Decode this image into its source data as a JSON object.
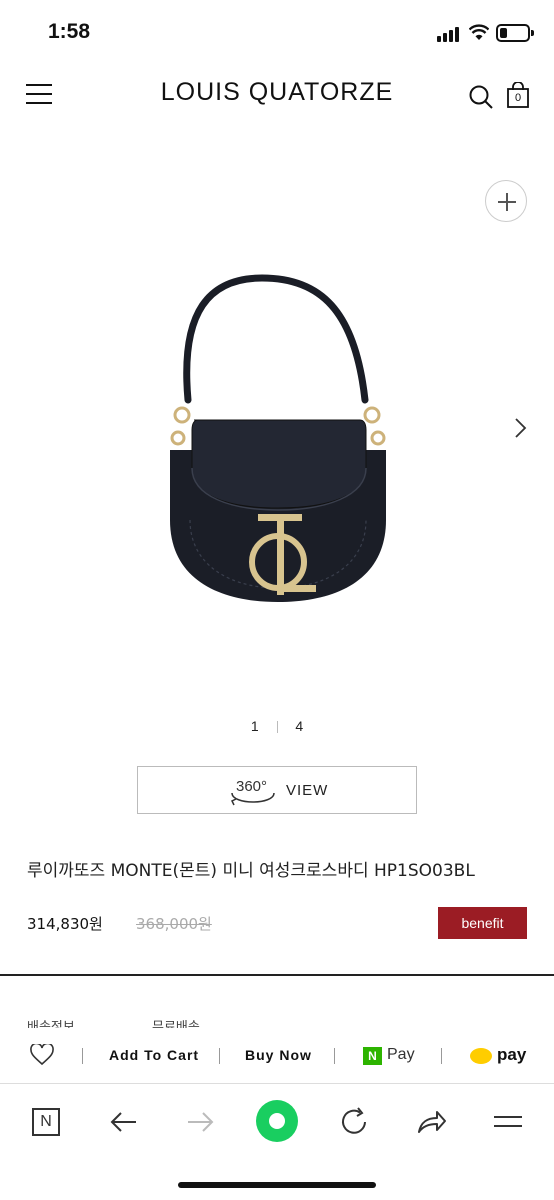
{
  "status_bar": {
    "time": "1:58",
    "battery_level": 0.25
  },
  "header": {
    "brand": "LOUIS QUATORZE",
    "cart_count": "0"
  },
  "gallery": {
    "current": "1",
    "total": "4"
  },
  "view_360": {
    "badge": "360°",
    "label": "VIEW"
  },
  "product": {
    "title": "루이까또즈 MONTE(몬트) 미니 여성크로스바디 HP1SO03BL",
    "price": "314,830원",
    "original_price": "368,000원",
    "benefit_label": "benefit",
    "benefit_color": "#9b1c24"
  },
  "partial_info": {
    "left": "배송정보",
    "right": "무료배송"
  },
  "action_bar": {
    "add_to_cart": "Add To Cart",
    "buy_now": "Buy Now",
    "npay_badge": "N",
    "npay_label": "Pay",
    "kakaopay_label": "pay"
  },
  "browser_bar": {
    "home_label": "N",
    "accent": "#19ce60"
  }
}
